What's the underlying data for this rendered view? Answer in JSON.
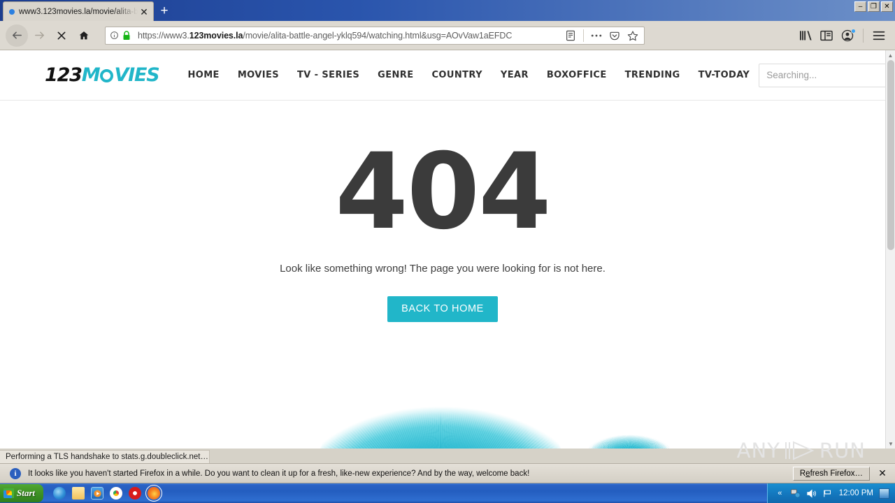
{
  "window": {
    "minimize_label": "–",
    "maximize_label": "❐",
    "close_label": "✕"
  },
  "browser": {
    "tab": {
      "title": "www3.123movies.la/movie/alita-b",
      "close_label": "✕"
    },
    "newtab_label": "+",
    "url": {
      "protocol": "https://www3.",
      "domain": "123movies.la",
      "path": "/movie/alita-battle-angel-yklq594/watching.html&usg=AOvVaw1aEFDC",
      "full": "https://www3.123movies.la/movie/alita-battle-angel-yklq594/watching.html&usg=AOvVaw1aEFDC"
    }
  },
  "site": {
    "logo": {
      "part1": "123",
      "part2": "M",
      "part3": "VIES"
    },
    "nav": [
      {
        "label": "HOME"
      },
      {
        "label": "MOVIES"
      },
      {
        "label": "TV - SERIES"
      },
      {
        "label": "GENRE"
      },
      {
        "label": "COUNTRY"
      },
      {
        "label": "YEAR"
      },
      {
        "label": "BOXOFFICE"
      },
      {
        "label": "TRENDING"
      },
      {
        "label": "TV-TODAY"
      }
    ],
    "search": {
      "placeholder": "Searching...",
      "value": ""
    },
    "error": {
      "code": "404",
      "message": "Look like something wrong! The page you were looking for is not here.",
      "button_label": "BACK TO HOME"
    },
    "accent_color": "#21b6c9"
  },
  "status": {
    "text": "Performing a TLS handshake to stats.g.doubleclick.net…"
  },
  "notification": {
    "text": "It looks like you haven't started Firefox in a while. Do you want to clean it up for a fresh, like-new experience? And by the way, welcome back!",
    "button_prefix": "R",
    "button_accel": "e",
    "button_suffix": "fresh Firefox…",
    "close_label": "✕"
  },
  "watermark": {
    "left": "ANY",
    "right": "RUN"
  },
  "taskbar": {
    "start_label": "Start",
    "time": "12:00 PM"
  }
}
